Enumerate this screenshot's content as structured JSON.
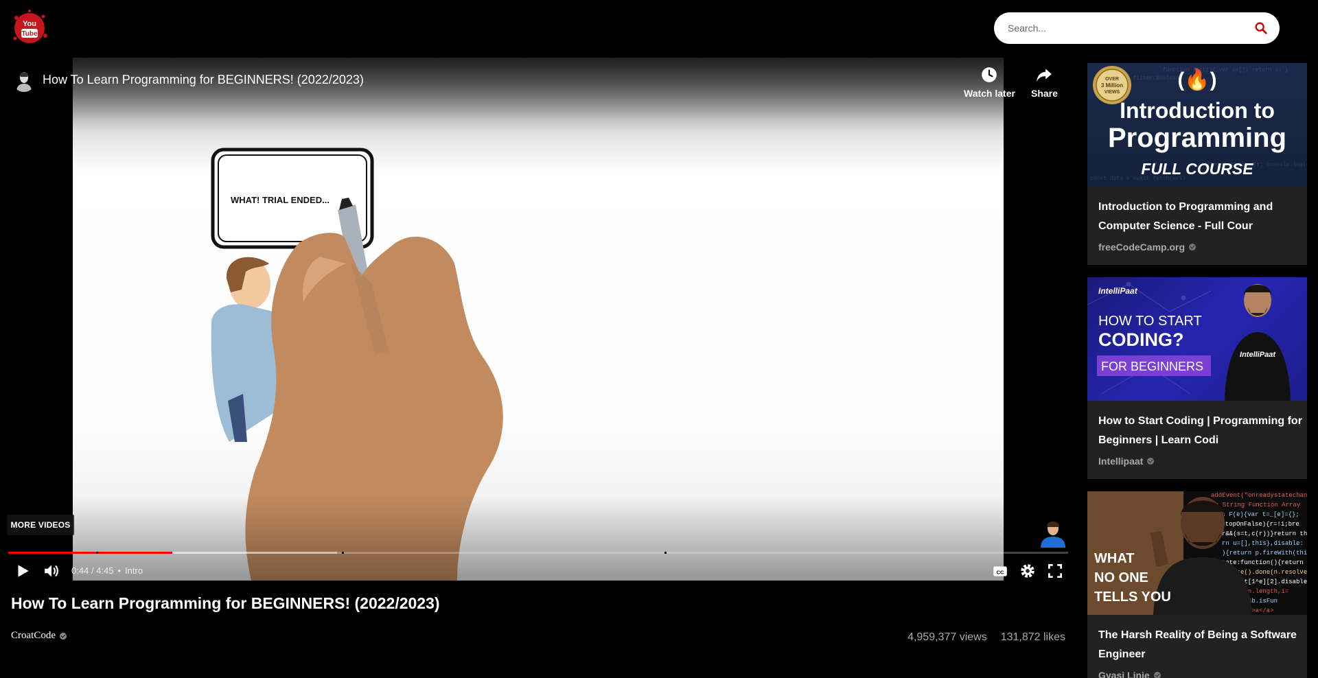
{
  "header": {
    "logo_text_top": "You",
    "logo_text_bottom": "Tube",
    "search_placeholder": "Search..."
  },
  "player": {
    "title": "How To Learn Programming for BEGINNERS! (2022/2023)",
    "watch_later_label": "Watch later",
    "share_label": "Share",
    "more_videos_label": "MORE VIDEOS",
    "current_time": "0:44",
    "duration": "4:45",
    "time_separator": "/",
    "chapter": "Intro",
    "played_fraction": 0.155,
    "buffered_fraction": 0.31,
    "chapter_marks": [
      0.083,
      0.315,
      0.619
    ],
    "whiteboard_text": "WHAT! TRIAL ENDED..."
  },
  "video": {
    "title": "How To Learn Programming for BEGINNERS! (2022/2023)",
    "channel": "CroatCode",
    "views": "4,959,377 views",
    "likes": "131,872 likes"
  },
  "sidebar": {
    "cards": [
      {
        "title": "Introduction to Programming and Computer Science - Full Cour",
        "channel": "freeCodeCamp.org",
        "thumb_line1": "Introduction to",
        "thumb_line2": "Programming",
        "thumb_line3": "FULL COURSE",
        "badge_line1": "OVER",
        "badge_line2": "3 Million",
        "badge_line3": "VIEWS",
        "logo": "(🔥)"
      },
      {
        "title": "How to Start Coding | Programming for Beginners | Learn Codi",
        "channel": "Intellipaat",
        "thumb_brand": "IntelliPaat",
        "thumb_line1": "HOW TO START",
        "thumb_line2": "CODING?",
        "thumb_line3": "FOR BEGINNERS"
      },
      {
        "title": "The Harsh Reality of Being a Software Engineer",
        "channel": "Gyasi Linje",
        "thumb_line1": "WHAT",
        "thumb_line2": "NO ONE",
        "thumb_line3": "TELLS YOU"
      }
    ]
  },
  "colors": {
    "progress_played": "#ff0000",
    "search_icon": "#cc0000",
    "card_background": "#222222"
  }
}
